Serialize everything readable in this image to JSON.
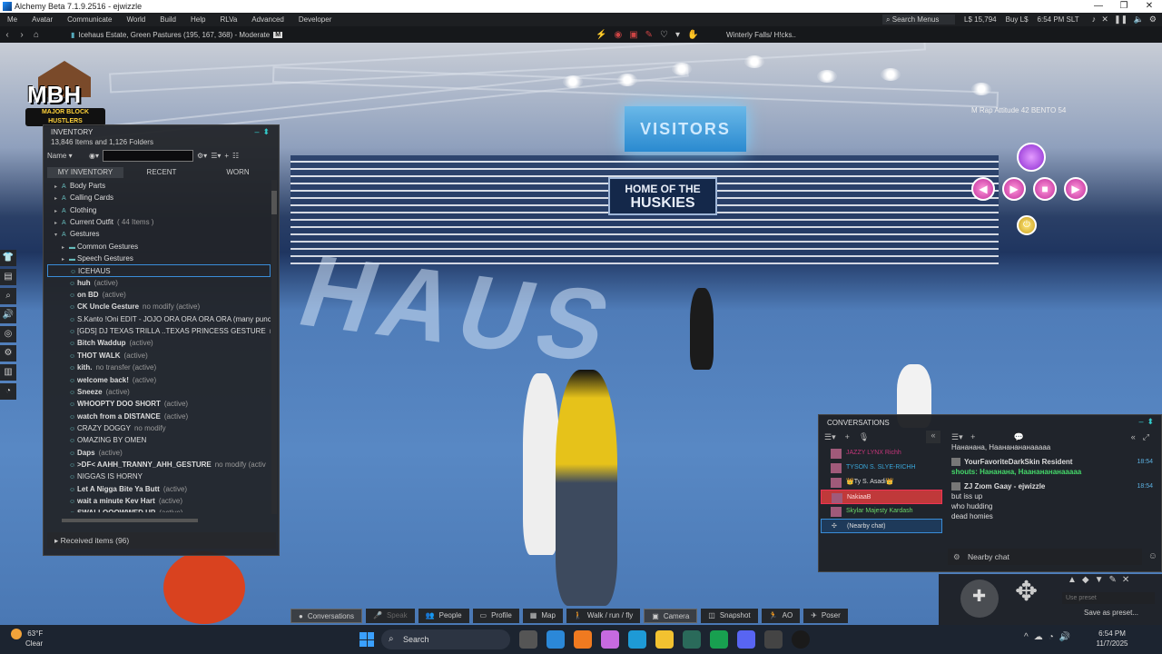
{
  "titlebar": {
    "title": "Alchemy Beta 7.1.9.2516 - ejwizzle",
    "minimize": "—",
    "maximize": "❐",
    "close": "✕"
  },
  "menubar": {
    "items": [
      "Me",
      "Avatar",
      "Communicate",
      "World",
      "Build",
      "Help",
      "RLVa",
      "Advanced",
      "Developer"
    ],
    "search_placeholder": "Search Menus",
    "balance": "L$ 15,794",
    "buy": "Buy L$",
    "time": "6:54 PM SLT"
  },
  "navbar": {
    "location": "Icehaus Estate, Green Pastures (195, 167, 368) - Moderate",
    "maturity": "M",
    "favorite": "Winterly Falls/ H!cks.."
  },
  "world": {
    "visitors_sign": "VISITORS",
    "huskies_sign_1": "HOME OF THE",
    "huskies_sign_2": "HUSKIES",
    "floor_text": "HAUS",
    "hud_label": "M Rap Attitude 42 BENTO 54",
    "logo_letters": "MBH",
    "logo_sub": "MAJOR BLOCK HUSTLERS"
  },
  "inventory": {
    "title": "INVENTORY",
    "count": "13,846 Items and 1,126 Folders",
    "sort": "Name",
    "search_value": "",
    "tabs": [
      "MY INVENTORY",
      "RECENT",
      "WORN"
    ],
    "rows": [
      {
        "name": "Body Parts",
        "suffix": "",
        "arrow": "▸",
        "ic": "A",
        "indent": 2,
        "bold": false
      },
      {
        "name": "Calling Cards",
        "suffix": "",
        "arrow": "▸",
        "ic": "A",
        "indent": 2,
        "bold": false
      },
      {
        "name": "Clothing",
        "suffix": "",
        "arrow": "▸",
        "ic": "A",
        "indent": 2,
        "bold": false
      },
      {
        "name": "Current Outfit",
        "suffix": "( 44 Items )",
        "arrow": "▸",
        "ic": "A",
        "indent": 2,
        "bold": false
      },
      {
        "name": "Gestures",
        "suffix": "",
        "arrow": "▾",
        "ic": "A",
        "indent": 2,
        "bold": false
      },
      {
        "name": "Common Gestures",
        "suffix": "",
        "arrow": "▸",
        "ic": "▬",
        "indent": 3,
        "bold": false
      },
      {
        "name": "Speech Gestures",
        "suffix": "",
        "arrow": "▸",
        "ic": "▬",
        "indent": 3,
        "bold": false
      },
      {
        "name": "ICEHAUS",
        "suffix": "",
        "arrow": "",
        "ic": "☺",
        "indent": 3,
        "bold": false,
        "selected": true
      },
      {
        "name": "huh",
        "suffix": "(active)",
        "arrow": "",
        "ic": "☺",
        "indent": 3,
        "bold": true
      },
      {
        "name": "on BD",
        "suffix": "(active)",
        "arrow": "",
        "ic": "☺",
        "indent": 3,
        "bold": true
      },
      {
        "name": "CK Uncle Gesture",
        "suffix": "no modify (active)",
        "arrow": "",
        "ic": "☺",
        "indent": 3,
        "bold": true
      },
      {
        "name": "S.Kanto !Oni EDIT - JOJO ORA ORA ORA ORA (many punch)",
        "suffix": "",
        "arrow": "",
        "ic": "☺",
        "indent": 3,
        "bold": false
      },
      {
        "name": "[GDS] DJ TEXAS TRILLA ..TEXAS PRINCESS GESTURE",
        "suffix": "no m",
        "arrow": "",
        "ic": "☺",
        "indent": 3,
        "bold": false
      },
      {
        "name": "Bitch Waddup",
        "suffix": "(active)",
        "arrow": "",
        "ic": "☺",
        "indent": 3,
        "bold": true
      },
      {
        "name": "THOT WALK",
        "suffix": "(active)",
        "arrow": "",
        "ic": "☺",
        "indent": 3,
        "bold": true
      },
      {
        "name": "kith.",
        "suffix": "no transfer (active)",
        "arrow": "",
        "ic": "☺",
        "indent": 3,
        "bold": true
      },
      {
        "name": "welcome back!",
        "suffix": "(active)",
        "arrow": "",
        "ic": "☺",
        "indent": 3,
        "bold": true
      },
      {
        "name": "Sneeze",
        "suffix": "(active)",
        "arrow": "",
        "ic": "☺",
        "indent": 3,
        "bold": true
      },
      {
        "name": "WHOOPTY DOO SHORT",
        "suffix": "(active)",
        "arrow": "",
        "ic": "☺",
        "indent": 3,
        "bold": true
      },
      {
        "name": "watch from a DISTANCE",
        "suffix": "(active)",
        "arrow": "",
        "ic": "☺",
        "indent": 3,
        "bold": true
      },
      {
        "name": "CRAZY DOGGY",
        "suffix": "no modify",
        "arrow": "",
        "ic": "☺",
        "indent": 3,
        "bold": false
      },
      {
        "name": "OMAZING BY OMEN",
        "suffix": "",
        "arrow": "",
        "ic": "☺",
        "indent": 3,
        "bold": false
      },
      {
        "name": "Daps",
        "suffix": "(active)",
        "arrow": "",
        "ic": "☺",
        "indent": 3,
        "bold": true
      },
      {
        "name": ">DF< AAHH_TRANNY_AHH_GESTURE",
        "suffix": "no modify (activ",
        "arrow": "",
        "ic": "☺",
        "indent": 3,
        "bold": true
      },
      {
        "name": "NIGGAS IS HORNY",
        "suffix": "",
        "arrow": "",
        "ic": "☺",
        "indent": 3,
        "bold": false
      },
      {
        "name": "Let A Nigga Bite Ya Butt",
        "suffix": "(active)",
        "arrow": "",
        "ic": "☺",
        "indent": 3,
        "bold": true
      },
      {
        "name": "wait a minute Kev Hart",
        "suffix": "(active)",
        "arrow": "",
        "ic": "☺",
        "indent": 3,
        "bold": true
      },
      {
        "name": "SWALLOOOWWED UP",
        "suffix": "(active)",
        "arrow": "",
        "ic": "☺",
        "indent": 3,
        "bold": true
      }
    ],
    "received": "Received items (96)"
  },
  "conversations": {
    "title": "CONVERSATIONS",
    "participants": [
      {
        "name": "JAZZY LYNX Richh",
        "color": "#c6367a",
        "style": ""
      },
      {
        "name": "TYSON S. SLYE-RICHH",
        "color": "#3aa6d8",
        "style": ""
      },
      {
        "name": "👑Ty S. Asadi👑",
        "color": "#dddddd",
        "style": ""
      },
      {
        "name": "NakiaaB",
        "color": "#ffdddd",
        "style": "sel"
      },
      {
        "name": "Skylar Majesty Kardash",
        "color": "#6ad86a",
        "style": ""
      },
      {
        "name": "(Nearby chat)",
        "color": "#dddddd",
        "style": "nearby"
      }
    ],
    "messages": [
      {
        "sender": "",
        "text": "Нананана, Наананананааааа",
        "time": ""
      },
      {
        "sender": "YourFavoriteDarkSkin Resident",
        "text": "",
        "time": "18:54"
      },
      {
        "sender": "",
        "text": "shouts: Нананана, Наананананааааа",
        "time": "",
        "shout": true
      },
      {
        "sender": "ZJ Zıom Gaay - ejwizzle",
        "text": "",
        "time": "18:54"
      },
      {
        "sender": "",
        "text": "but iss up",
        "time": ""
      },
      {
        "sender": "",
        "text": "who hudding",
        "time": ""
      },
      {
        "sender": "",
        "text": "dead homies",
        "time": ""
      }
    ],
    "input_placeholder": "Nearby chat"
  },
  "cam_controls": {
    "preset_placeholder": "Use preset",
    "save_preset": "Save as preset..."
  },
  "bottom_toolbar": [
    {
      "icon": "●",
      "label": "Conversations",
      "state": "active"
    },
    {
      "icon": "🎤",
      "label": "Speak",
      "state": "disabled"
    },
    {
      "icon": "👥",
      "label": "People",
      "state": ""
    },
    {
      "icon": "▭",
      "label": "Profile",
      "state": ""
    },
    {
      "icon": "▦",
      "label": "Map",
      "state": ""
    },
    {
      "icon": "🚶",
      "label": "Walk / run / fly",
      "state": ""
    },
    {
      "icon": "▣",
      "label": "Camera",
      "state": "active"
    },
    {
      "icon": "◫",
      "label": "Snapshot",
      "state": ""
    },
    {
      "icon": "🏃",
      "label": "AO",
      "state": ""
    },
    {
      "icon": "✈",
      "label": "Poser",
      "state": ""
    }
  ],
  "taskbar": {
    "temperature": "63°F",
    "condition": "Clear",
    "search": "Search",
    "time": "6:54 PM",
    "date": "11/7/2025"
  }
}
